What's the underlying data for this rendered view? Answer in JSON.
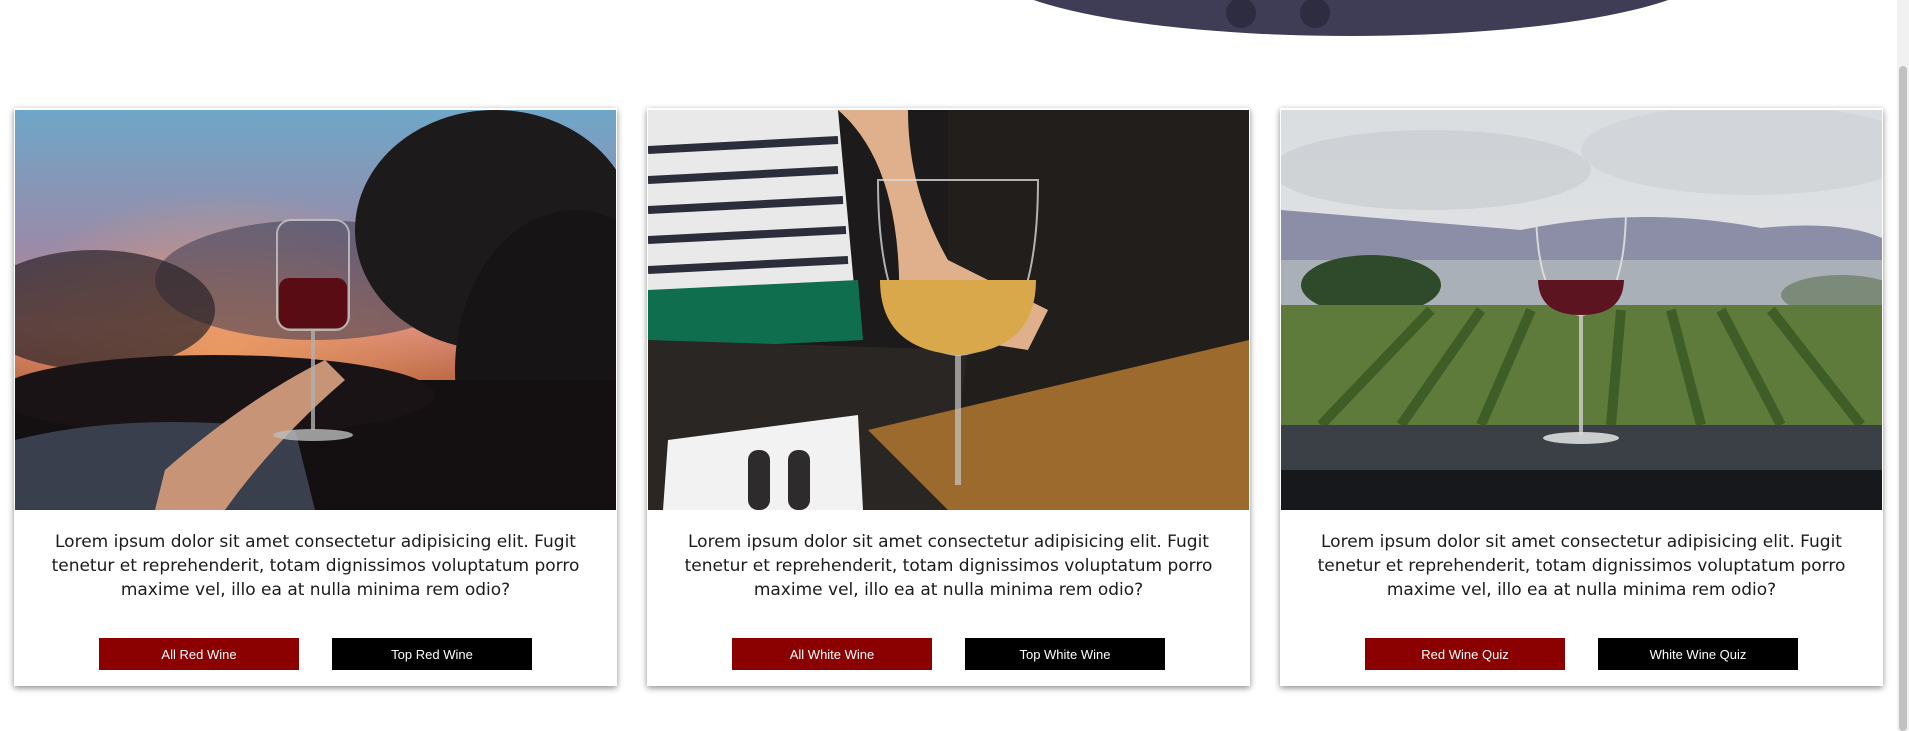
{
  "colors": {
    "banner": "#3f3d56",
    "button_red": "#8b0000",
    "button_black": "#000000",
    "text": "#1b1b1b"
  },
  "cards": [
    {
      "image": "red-wine-sunset-photo",
      "text": "Lorem ipsum dolor sit amet consectetur adipisicing elit. Fugit tenetur et reprehenderit, totam dignissimos voluptatum porro maxime vel, illo ea at nulla minima rem odio?",
      "primary_button": "All Red Wine",
      "secondary_button": "Top Red Wine"
    },
    {
      "image": "white-wine-glass-photo",
      "text": "Lorem ipsum dolor sit amet consectetur adipisicing elit. Fugit tenetur et reprehenderit, totam dignissimos voluptatum porro maxime vel, illo ea at nulla minima rem odio?",
      "primary_button": "All White Wine",
      "secondary_button": "Top White Wine"
    },
    {
      "image": "vineyard-wine-glass-photo",
      "text": "Lorem ipsum dolor sit amet consectetur adipisicing elit. Fugit tenetur et reprehenderit, totam dignissimos voluptatum porro maxime vel, illo ea at nulla minima rem odio?",
      "primary_button": "Red Wine Quiz",
      "secondary_button": "White Wine Quiz"
    }
  ]
}
